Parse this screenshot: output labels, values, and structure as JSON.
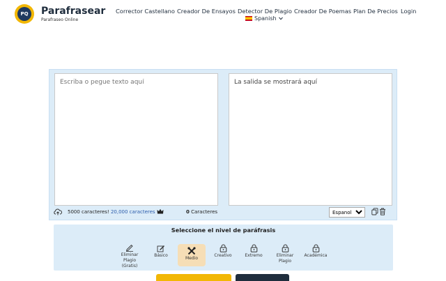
{
  "brand": {
    "logo_text": "PQ",
    "name": "Parafrasear",
    "tagline": "Parafraseo Online"
  },
  "nav": {
    "items": [
      "Corrector Castellano",
      "Creador De Ensayos",
      "Detector De Plagio",
      "Creador De Poemas",
      "Plan De Precios",
      "Login"
    ],
    "language": "Spanish"
  },
  "editor": {
    "input_placeholder": "Escriba o pegue texto aquí",
    "output_placeholder": "La salida se mostrará aquí",
    "char_limit_text": "5000 caracteres!",
    "char_limit_premium": "20,000 caracteres",
    "char_count": "0",
    "char_count_label": "Caracteres",
    "language_selected": "Espanol"
  },
  "levels": {
    "title": "Seleccione el nivel de paráfrasis",
    "items": [
      {
        "label": "Eliminar Plagio (Gratis)",
        "icon": "pen-icon"
      },
      {
        "label": "Básico",
        "icon": "pen-edit-icon"
      },
      {
        "label": "Medio",
        "icon": "tools-icon"
      },
      {
        "label": "Creativo",
        "icon": "lock-icon"
      },
      {
        "label": "Extremo",
        "icon": "lock-icon"
      },
      {
        "label": "Eliminar Plagio",
        "icon": "lock-icon"
      },
      {
        "label": "Académica",
        "icon": "lock-icon"
      }
    ],
    "selected": "Medio"
  },
  "colors": {
    "accent_yellow": "#f2b705",
    "navy": "#1f2d3d",
    "panel_blue": "#dcecf8",
    "link_blue": "#2b5cab",
    "selected_level": "#f6deb6"
  }
}
